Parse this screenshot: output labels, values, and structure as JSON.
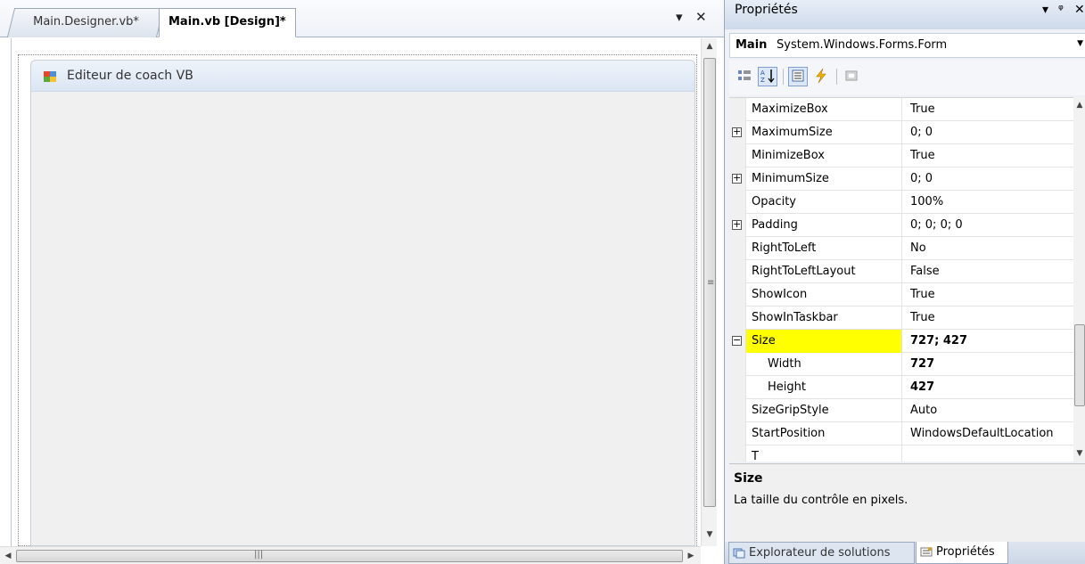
{
  "designer": {
    "tabs": [
      {
        "label": "Main.Designer.vb*"
      },
      {
        "label": "Main.vb [Design]*"
      }
    ],
    "form_title": "Editeur de coach VB"
  },
  "properties": {
    "title": "Propriétés",
    "object_name": "Main",
    "object_type": "System.Windows.Forms.Form",
    "rows": [
      {
        "name": "MaximizeBox",
        "value": "True",
        "expandable": false
      },
      {
        "name": "MaximumSize",
        "value": "0; 0",
        "expandable": true
      },
      {
        "name": "MinimizeBox",
        "value": "True",
        "expandable": false
      },
      {
        "name": "MinimumSize",
        "value": "0; 0",
        "expandable": true
      },
      {
        "name": "Opacity",
        "value": "100%",
        "expandable": false
      },
      {
        "name": "Padding",
        "value": "0; 0; 0; 0",
        "expandable": true
      },
      {
        "name": "RightToLeft",
        "value": "No",
        "expandable": false
      },
      {
        "name": "RightToLeftLayout",
        "value": "False",
        "expandable": false
      },
      {
        "name": "ShowIcon",
        "value": "True",
        "expandable": false
      },
      {
        "name": "ShowInTaskbar",
        "value": "True",
        "expandable": false
      },
      {
        "name": "Size",
        "value": "727; 427",
        "expandable": true,
        "expanded": true,
        "selected": true
      },
      {
        "name": "Width",
        "value": "727",
        "child": true
      },
      {
        "name": "Height",
        "value": "427",
        "child": true
      },
      {
        "name": "SizeGripStyle",
        "value": "Auto",
        "expandable": false
      },
      {
        "name": "StartPosition",
        "value": "WindowsDefaultLocation",
        "expandable": false
      },
      {
        "name": "T",
        "value": "",
        "expandable": false
      }
    ],
    "description": {
      "title": "Size",
      "text": "La taille du contrôle en pixels."
    },
    "bottom_tabs": [
      {
        "label": "Explorateur de solutions"
      },
      {
        "label": "Propriétés"
      }
    ]
  },
  "colors": {
    "selection_highlight": "#ffff00",
    "title_gradient_top": "#e8eef7",
    "title_gradient_bottom": "#cdd9ea"
  },
  "icons": [
    "pin-icon",
    "close-icon",
    "dropdown-icon",
    "categorized-icon",
    "alphabetical-icon",
    "properties-icon",
    "events-icon",
    "property-pages-icon",
    "form-icon"
  ]
}
